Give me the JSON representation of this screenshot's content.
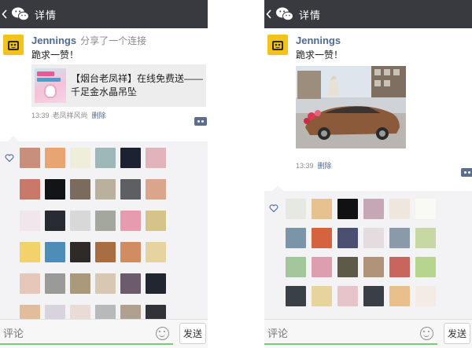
{
  "header": {
    "title": "详情"
  },
  "left_post": {
    "author": "Jennings",
    "shared_text": "分享了一个连接",
    "text": "跪求一赞！",
    "link": {
      "title": "【烟台老凤祥】在线免费送——千足金水晶吊坠"
    },
    "time": "13:39",
    "source": "老凤祥风尚",
    "delete_label": "删除"
  },
  "right_post": {
    "author": "Jennings",
    "text": "跪求一赞！",
    "time": "13:39",
    "delete_label": "删除"
  },
  "comment_bar": {
    "placeholder": "评论",
    "send_label": "发送"
  },
  "colors": {
    "header_bg": "#393a3f",
    "name": "#506994",
    "likes_bg": "#f3f3f5",
    "input_line": "#7cc57d"
  },
  "like_avatars_left": [
    "#c98f7d",
    "#e7a574",
    "#eeeeda",
    "#9eb7b8",
    "#1d2233",
    "#e3b3bc",
    "#c9786a",
    "#121418",
    "#7b6a5e",
    "#b9b09d",
    "#5d5f63",
    "#d9a58b",
    "#f0e6ec",
    "#282b31",
    "#d8d8d8",
    "#a4a79b",
    "#e69cae",
    "#d5c48a",
    "#f2d26a",
    "#4e8db8",
    "#2f2a27",
    "#a86e42",
    "#d08d62",
    "#e7d3a2",
    "#e6c8bb",
    "#9a9a98",
    "#aa997a",
    "#d7c7b3",
    "#6c5a6d",
    "#222631",
    "#e2bd9b",
    "#d9d3df",
    "#e9dcd6",
    "#b8b9bb",
    "#b0a08f",
    "#313338"
  ],
  "like_avatars_right": [
    "#e6e8e2",
    "#e7c291",
    "#111114",
    "#c6a7b5",
    "#efe6dd",
    "#fafaf5",
    "#7a95a7",
    "#d5633f",
    "#4b4f71",
    "#e5dce0",
    "#8b9aa8",
    "#c8d8a4",
    "#a3c69d",
    "#dd9eb0",
    "#5e5a48",
    "#b09378",
    "#c8665d",
    "#b7d58e",
    "#394046",
    "#e6d39e",
    "#e7c4c9",
    "#3a3f47",
    "#e9c08c",
    "#f4ebe4"
  ]
}
